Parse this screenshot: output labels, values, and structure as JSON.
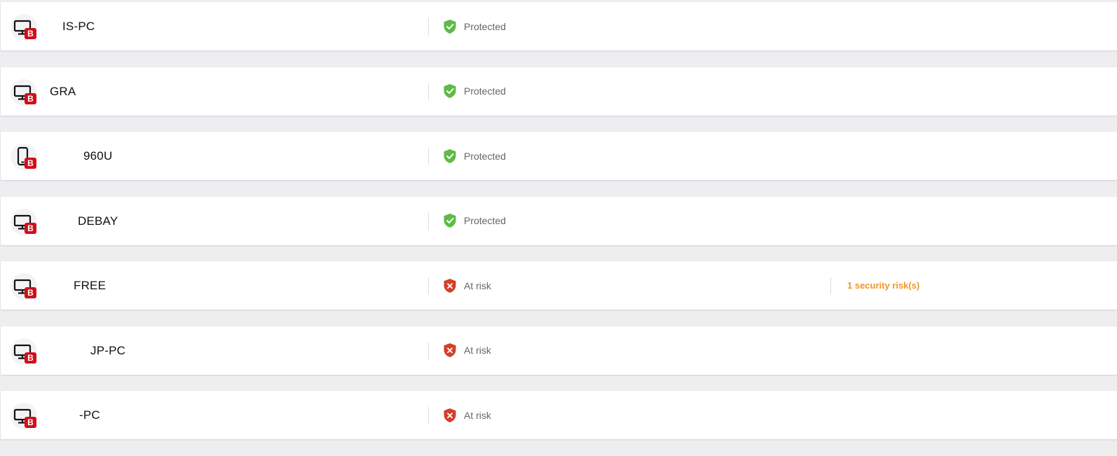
{
  "colors": {
    "protected": "#5dbb46",
    "at_risk": "#d2402c",
    "risk_link": "#f0962a",
    "badge": "#d10f1b"
  },
  "devices": [
    {
      "name": "IS-PC",
      "icon": "desktop-icon",
      "badge": "B",
      "status": "Protected",
      "status_icon": "shield-check-icon",
      "risk": ""
    },
    {
      "name": "GRA",
      "icon": "desktop-icon",
      "badge": "B",
      "status": "Protected",
      "status_icon": "shield-check-icon",
      "risk": ""
    },
    {
      "name": "960U",
      "icon": "phone-icon",
      "badge": "B",
      "status": "Protected",
      "status_icon": "shield-check-icon",
      "risk": ""
    },
    {
      "name": "DEBAY",
      "icon": "desktop-icon",
      "badge": "B",
      "status": "Protected",
      "status_icon": "shield-check-icon",
      "risk": ""
    },
    {
      "name": "FREE",
      "icon": "desktop-icon",
      "badge": "B",
      "status": "At risk",
      "status_icon": "shield-x-icon",
      "risk": "1 security risk(s)"
    },
    {
      "name": "JP-PC",
      "icon": "desktop-icon",
      "badge": "B",
      "status": "At risk",
      "status_icon": "shield-x-icon",
      "risk": ""
    },
    {
      "name": "-PC",
      "icon": "desktop-icon",
      "badge": "B",
      "status": "At risk",
      "status_icon": "shield-x-icon",
      "risk": ""
    }
  ]
}
